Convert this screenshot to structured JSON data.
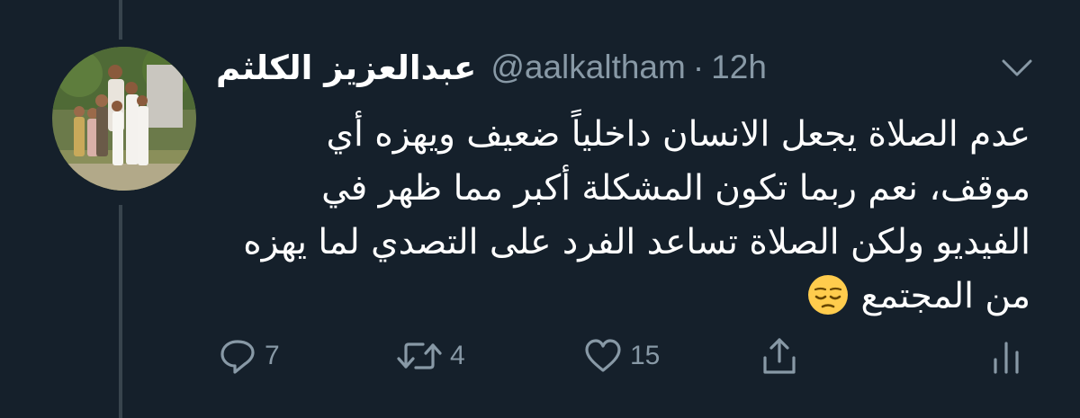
{
  "tweet": {
    "author": {
      "display_name": "عبدالعزيز الكلثم",
      "handle": "@aalkaltham"
    },
    "separator": "·",
    "time": "12h",
    "text": "عدم الصلاة يجعل الانسان داخلياً ضعيف ويهزه أي موقف، نعم ربما تكون المشكلة أكبر مما ظهر في الفيديو ولكن الصلاة تساعد الفرد على التصدي لما يهزه من المجتمع",
    "emoji": "pensive-face-emoji",
    "actions": {
      "reply": {
        "icon": "reply-icon",
        "count": "7"
      },
      "retweet": {
        "icon": "retweet-icon",
        "count": "4"
      },
      "like": {
        "icon": "heart-icon",
        "count": "15"
      },
      "share": {
        "icon": "share-icon"
      },
      "analytics": {
        "icon": "analytics-icon"
      }
    },
    "menu_icon": "chevron-down-icon"
  },
  "colors": {
    "background": "#15202b",
    "thread_line": "#38444d",
    "primary_text": "#ffffff",
    "secondary_text": "#8899a6",
    "emoji_yellow": "#ffcc4d"
  }
}
